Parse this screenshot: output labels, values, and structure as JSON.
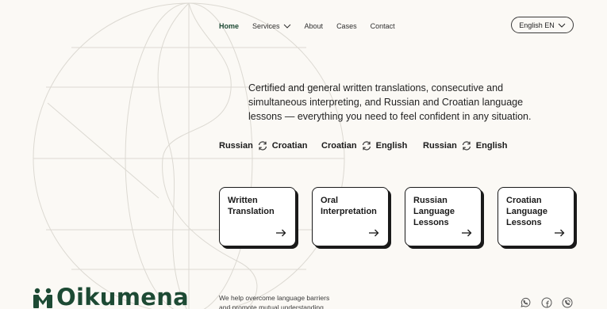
{
  "nav": {
    "items": [
      {
        "label": "Home",
        "active": true
      },
      {
        "label": "Services",
        "dropdown": true
      },
      {
        "label": "About"
      },
      {
        "label": "Cases"
      },
      {
        "label": "Contact"
      }
    ],
    "language": "English EN"
  },
  "hero": {
    "description": "Certified and general written translations, consecutive and simultaneous interpreting, and Russian and Croatian language lessons — everything you need to feel confident in any situation."
  },
  "pairs": [
    {
      "from": "Russian",
      "to": "Croatian"
    },
    {
      "from": "Croatian",
      "to": "English"
    },
    {
      "from": "Russian",
      "to": "English"
    }
  ],
  "services": [
    {
      "title_lines": [
        "Written",
        "Translation"
      ]
    },
    {
      "title_lines": [
        "Oral",
        "Interpretation"
      ]
    },
    {
      "title_lines": [
        "Russian",
        "Language",
        "Lessons"
      ]
    },
    {
      "title_lines": [
        "Croatian",
        "Language",
        "Lessons"
      ]
    }
  ],
  "footer": {
    "logo_text": "Oikumena",
    "tagline_lines": [
      "We help overcome language barriers",
      "and promote mutual understanding"
    ],
    "social_icons": [
      "whatsapp-icon",
      "facebook-icon",
      "viber-icon"
    ]
  },
  "colors": {
    "background": "#fbf9f5",
    "brand_green": "#1d4a34",
    "ink": "#1a1a1a",
    "globe_lines": "#d9d6cf"
  }
}
